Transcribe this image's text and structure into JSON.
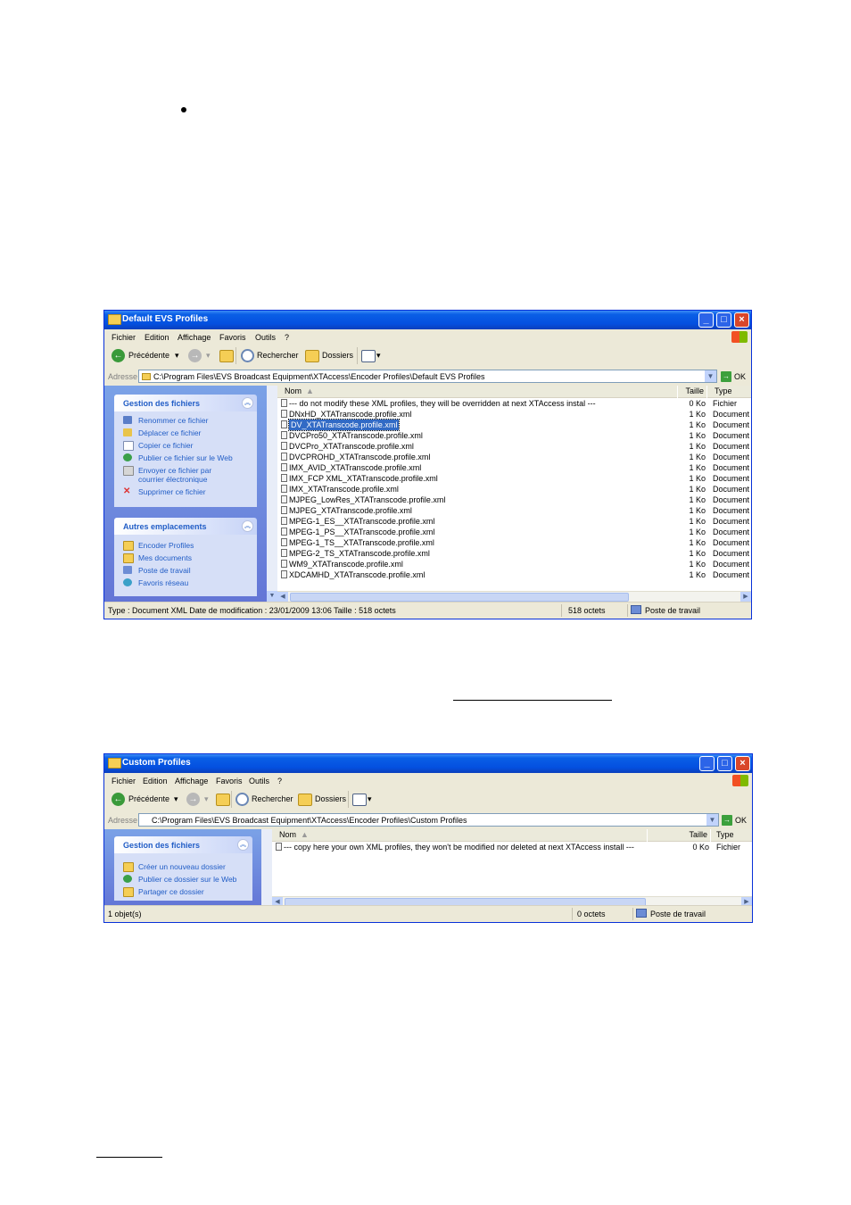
{
  "window1": {
    "title": "Default EVS Profiles",
    "menus": [
      "Fichier",
      "Edition",
      "Affichage",
      "Favoris",
      "Outils",
      "?"
    ],
    "toolbar": {
      "back": "Précédente",
      "search": "Rechercher",
      "folders": "Dossiers"
    },
    "address_label": "Adresse",
    "address": "C:\\Program Files\\EVS Broadcast Equipment\\XTAccess\\Encoder Profiles\\Default EVS Profiles",
    "go": "OK",
    "panel1": {
      "title": "Gestion des fichiers",
      "tasks": [
        "Renommer ce fichier",
        "Déplacer ce fichier",
        "Copier ce fichier",
        "Publier ce fichier sur le Web",
        "Envoyer ce fichier par",
        "courrier électronique",
        "Supprimer ce fichier"
      ]
    },
    "panel2": {
      "title": "Autres emplacements",
      "tasks": [
        "Encoder Profiles",
        "Mes documents",
        "Poste de travail",
        "Favoris réseau"
      ]
    },
    "columns": {
      "name": "Nom",
      "size": "Taille",
      "type": "Type"
    },
    "files": [
      {
        "name": "--- do not modify these XML profiles, they will be overridden at next XTAccess instal ---",
        "size": "0 Ko",
        "type": "Fichier"
      },
      {
        "name": "DNxHD_XTATranscode.profile.xml",
        "size": "1 Ko",
        "type": "Document"
      },
      {
        "name": "DV_XTATranscode.profile.xml",
        "size": "1 Ko",
        "type": "Document"
      },
      {
        "name": "DVCPro50_XTATranscode.profile.xml",
        "size": "1 Ko",
        "type": "Document"
      },
      {
        "name": "DVCPro_XTATranscode.profile.xml",
        "size": "1 Ko",
        "type": "Document"
      },
      {
        "name": "DVCPROHD_XTATranscode.profile.xml",
        "size": "1 Ko",
        "type": "Document"
      },
      {
        "name": "IMX_AVID_XTATranscode.profile.xml",
        "size": "1 Ko",
        "type": "Document"
      },
      {
        "name": "IMX_FCP XML_XTATranscode.profile.xml",
        "size": "1 Ko",
        "type": "Document"
      },
      {
        "name": "IMX_XTATranscode.profile.xml",
        "size": "1 Ko",
        "type": "Document"
      },
      {
        "name": "MJPEG_LowRes_XTATranscode.profile.xml",
        "size": "1 Ko",
        "type": "Document"
      },
      {
        "name": "MJPEG_XTATranscode.profile.xml",
        "size": "1 Ko",
        "type": "Document"
      },
      {
        "name": "MPEG-1_ES__XTATranscode.profile.xml",
        "size": "1 Ko",
        "type": "Document"
      },
      {
        "name": "MPEG-1_PS__XTATranscode.profile.xml",
        "size": "1 Ko",
        "type": "Document"
      },
      {
        "name": "MPEG-1_TS__XTATranscode.profile.xml",
        "size": "1 Ko",
        "type": "Document"
      },
      {
        "name": "MPEG-2_TS_XTATranscode.profile.xml",
        "size": "1 Ko",
        "type": "Document"
      },
      {
        "name": "WM9_XTATranscode.profile.xml",
        "size": "1 Ko",
        "type": "Document"
      },
      {
        "name": "XDCAMHD_XTATranscode.profile.xml",
        "size": "1 Ko",
        "type": "Document"
      }
    ],
    "status": {
      "info": "Type : Document XML Date de modification : 23/01/2009 13:06 Taille  : 518 octets",
      "size": "518 octets",
      "location": "Poste de travail"
    }
  },
  "window2": {
    "title": "Custom Profiles",
    "menus": [
      "Fichier",
      "Edition",
      "Affichage",
      "Favoris",
      "Outils",
      "?"
    ],
    "toolbar": {
      "back": "Précédente",
      "search": "Rechercher",
      "folders": "Dossiers"
    },
    "address_label": "Adresse",
    "address": "C:\\Program Files\\EVS Broadcast Equipment\\XTAccess\\Encoder Profiles\\Custom Profiles",
    "go": "OK",
    "panel1": {
      "title": "Gestion des fichiers",
      "tasks": [
        "Créer un nouveau dossier",
        "Publier ce dossier sur le Web",
        "Partager ce dossier"
      ]
    },
    "columns": {
      "name": "Nom",
      "size": "Taille",
      "type": "Type"
    },
    "files": [
      {
        "name": "--- copy here your own XML profiles, they won't be modified nor deleted at next XTAccess install ---",
        "size": "0 Ko",
        "type": "Fichier"
      }
    ],
    "status": {
      "info": "1 objet(s)",
      "size": "0 octets",
      "location": "Poste de travail"
    }
  }
}
